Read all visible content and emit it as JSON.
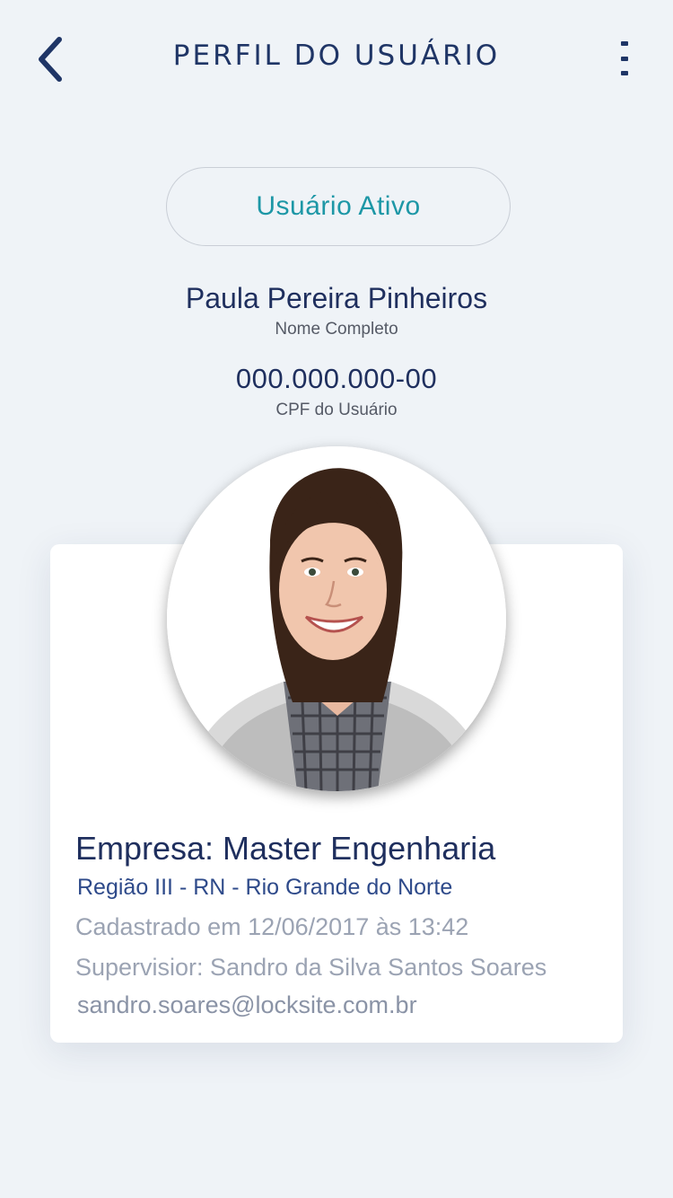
{
  "header": {
    "title": "PERFIL DO USUÁRIO",
    "back_icon": "chevron-left-icon",
    "menu_icon": "more-vertical-icon"
  },
  "status": {
    "label": "Usuário Ativo"
  },
  "user": {
    "name": "Paula Pereira Pinheiros",
    "name_caption": "Nome Completo",
    "cpf": "000.000.000-00",
    "cpf_caption": "CPF do Usuário"
  },
  "details": {
    "company": "Empresa: Master Engenharia",
    "region": "Região III - RN - Rio Grande do Norte",
    "registered": "Cadastrado em 12/06/2017 às 13:42",
    "supervisor": "Supervisior: Sandro da Silva Santos Soares",
    "email": "sandro.soares@locksite.com.br"
  },
  "colors": {
    "background": "#eff3f7",
    "primary": "#1f3566",
    "accent": "#1d97a6",
    "muted": "#9ba3b3"
  }
}
